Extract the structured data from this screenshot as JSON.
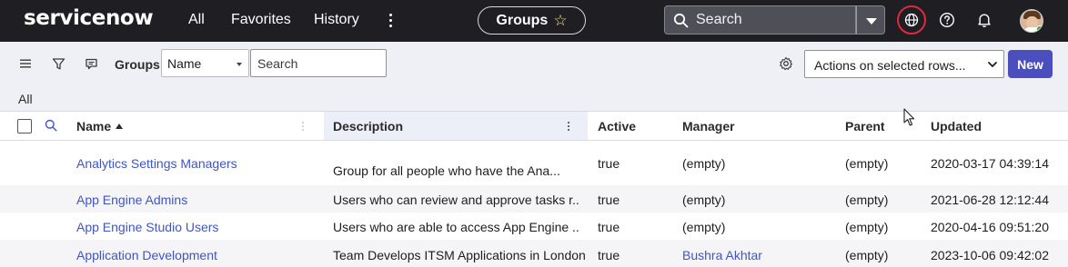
{
  "topnav": {
    "logo": "servicenow",
    "items": [
      "All",
      "Favorites",
      "History"
    ],
    "context_pill": "Groups",
    "search_placeholder": "Search"
  },
  "toolbar": {
    "title": "Groups",
    "field_selected": "Name",
    "search_placeholder": "Search",
    "actions_selected": "Actions on selected rows...",
    "new_label": "New"
  },
  "breadcrumb": "All",
  "table": {
    "columns": {
      "name": "Name",
      "description": "Description",
      "active": "Active",
      "manager": "Manager",
      "parent": "Parent",
      "updated": "Updated"
    },
    "sort": {
      "column": "Name",
      "direction": "ascending"
    },
    "rows": [
      {
        "name": "Analytics Settings Managers",
        "description": "Group for all people who have the Ana...",
        "active": "true",
        "manager": "(empty)",
        "parent": "(empty)",
        "updated": "2020-03-17 04:39:14"
      },
      {
        "name": "App Engine Admins",
        "description": "Users who can review and approve tasks r...",
        "active": "true",
        "manager": "(empty)",
        "parent": "(empty)",
        "updated": "2021-06-28 12:12:44"
      },
      {
        "name": "App Engine Studio Users",
        "description": "Users who are able to access App Engine ...",
        "active": "true",
        "manager": "(empty)",
        "parent": "(empty)",
        "updated": "2020-04-16 09:51:20"
      },
      {
        "name": "Application Development",
        "description": "Team Develops ITSM Applications in London",
        "active": "true",
        "manager": "Bushra Akhtar",
        "parent": "(empty)",
        "updated": "2023-10-06 09:42:02"
      }
    ]
  },
  "colors": {
    "nav_bg": "#1e1e23",
    "toolbar_bg": "#eef0f6",
    "link": "#3f55c7",
    "primary_button": "#4b4fbd",
    "focus_ring": "#e0283e"
  }
}
